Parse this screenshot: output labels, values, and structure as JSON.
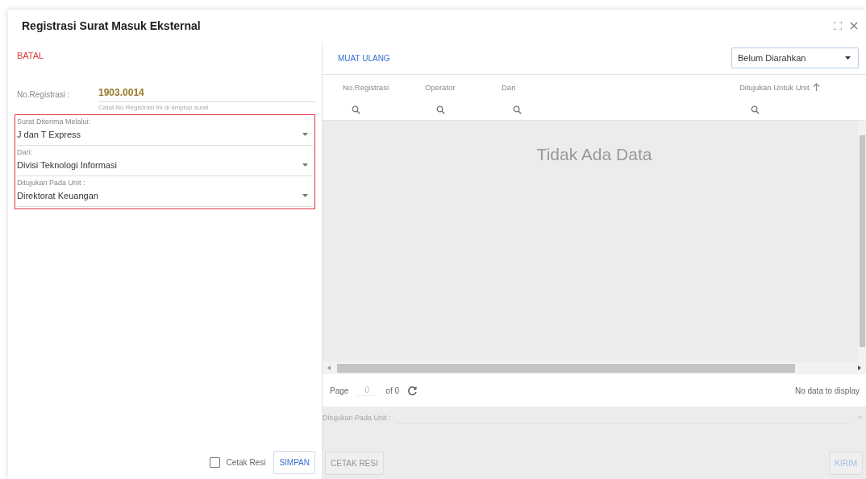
{
  "window": {
    "title": "Registrasi Surat Masuk Eksternal"
  },
  "left_panel": {
    "cancel_button": "BATAL",
    "registration": {
      "label": "No.Registrasi :",
      "value": "1903.0014",
      "hint": "Catat No Registrasi ini di amplop surat"
    },
    "field_group": {
      "highlighted": true,
      "fields": [
        {
          "label": "Surat Diterima Melalui:",
          "value": "J dan T Express"
        },
        {
          "label": "Dari:",
          "value": "Divisi Teknologi Informasi"
        },
        {
          "label": "Ditujukan Pada Unit :",
          "value": "Direktorat Keuangan"
        }
      ]
    },
    "print_receipt": {
      "label": "Cetak Resi",
      "checked": false
    },
    "save_button": "SIMPAN"
  },
  "right_panel": {
    "reload_button": "MUAT ULANG",
    "filter": {
      "value": "Belum Diarahkan"
    },
    "table": {
      "columns": [
        {
          "label": "No.Registrasi",
          "sorted": false
        },
        {
          "label": "Operator",
          "sorted": false
        },
        {
          "label": "Dari",
          "sorted": false
        },
        {
          "label": "Ditujukan Untuk Unit",
          "sorted": true
        }
      ],
      "empty_message": "Tidak Ada Data"
    },
    "pager": {
      "page_label": "Page",
      "page_value": "0",
      "of_label": "of 0",
      "status": "No data to display"
    },
    "footer": {
      "disabled": true,
      "field_label": "Ditujukan Pada Unit :",
      "print_button": "CETAK RESI",
      "send_button": "KIRIM"
    }
  }
}
